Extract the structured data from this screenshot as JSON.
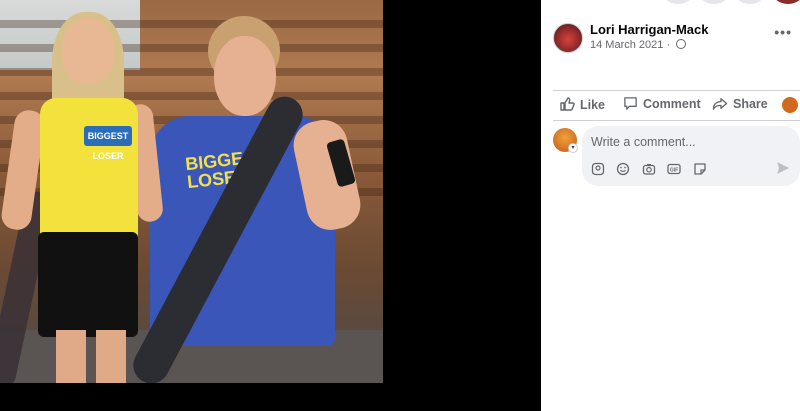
{
  "post": {
    "author": "Lori Harrigan-Mack",
    "date": "14 March 2021",
    "date_separator": "·",
    "photo_logo_text_1": "BIGGEST LOSER",
    "photo_logo_text_2": "BIGGEST LOSER"
  },
  "actions": {
    "like_label": "Like",
    "comment_label": "Comment",
    "share_label": "Share"
  },
  "comment": {
    "placeholder": "Write a comment..."
  },
  "icons": {
    "privacy": "globe-icon",
    "more": "more-options-icon",
    "like": "thumbs-up-icon",
    "comment": "speech-bubble-icon",
    "share": "share-arrow-icon",
    "tools": [
      "avatar-sticker-icon",
      "emoji-icon",
      "camera-icon",
      "gif-icon",
      "sticker-icon"
    ],
    "send": "send-icon"
  },
  "colors": {
    "text_primary": "#050505",
    "text_secondary": "#65676b",
    "comment_bg": "#f0f2f5",
    "divider": "#ced0d4"
  }
}
